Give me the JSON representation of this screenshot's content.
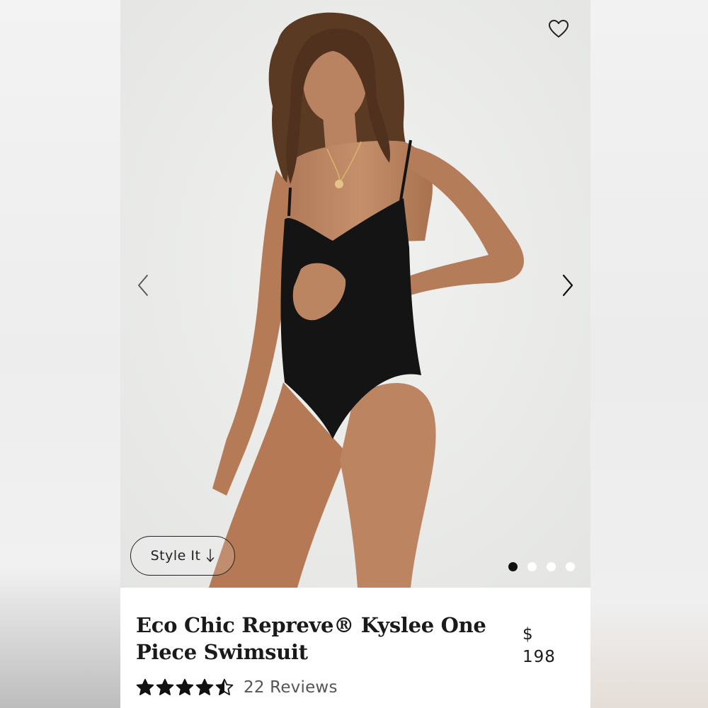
{
  "product": {
    "title": "Eco Chic Repreve® Kyslee One Piece Swimsuit",
    "price_currency": "$",
    "price_value": "198",
    "rating": 4.5,
    "reviews_label": "22 Reviews"
  },
  "gallery": {
    "style_button_label": "Style It",
    "style_button_icon": "arrow-down-icon",
    "dot_count": 4,
    "active_dot": 0
  },
  "icons": {
    "wishlist": "heart-outline-icon",
    "prev": "chevron-left-icon",
    "next": "chevron-right-icon",
    "star": "star-icon"
  }
}
